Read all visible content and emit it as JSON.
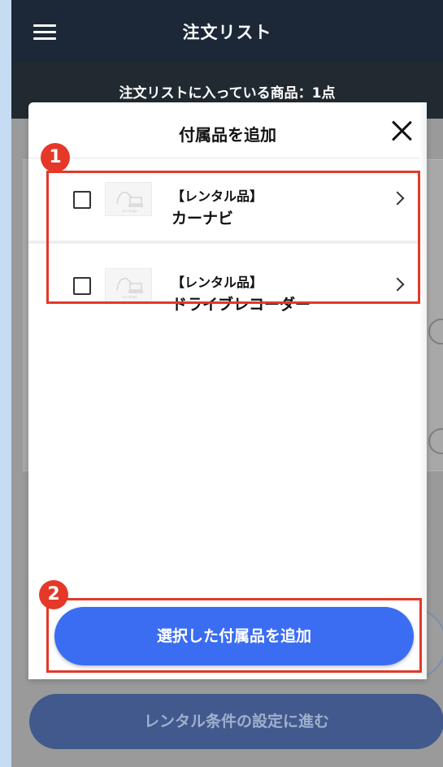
{
  "header": {
    "title": "注文リスト",
    "menu_icon": "hamburger-menu-icon"
  },
  "subheader": {
    "text": "注文リストに入っている商品：1点"
  },
  "modal": {
    "title": "付属品を追加",
    "close_icon": "close-icon",
    "items": [
      {
        "tag": "【レンタル品】",
        "name": "カーナビ",
        "checked": false
      },
      {
        "tag": "【レンタル品】",
        "name": "ドライブレコーダー",
        "checked": false
      }
    ],
    "add_button_label": "選択した付属品を追加"
  },
  "annotations": {
    "badge_1": "1",
    "badge_2": "2",
    "highlight_color": "#e53829"
  },
  "background": {
    "primary_button_label": "レンタル条件の設定に進む"
  },
  "colors": {
    "header": "#1c2838",
    "accent": "#3b6df2"
  }
}
